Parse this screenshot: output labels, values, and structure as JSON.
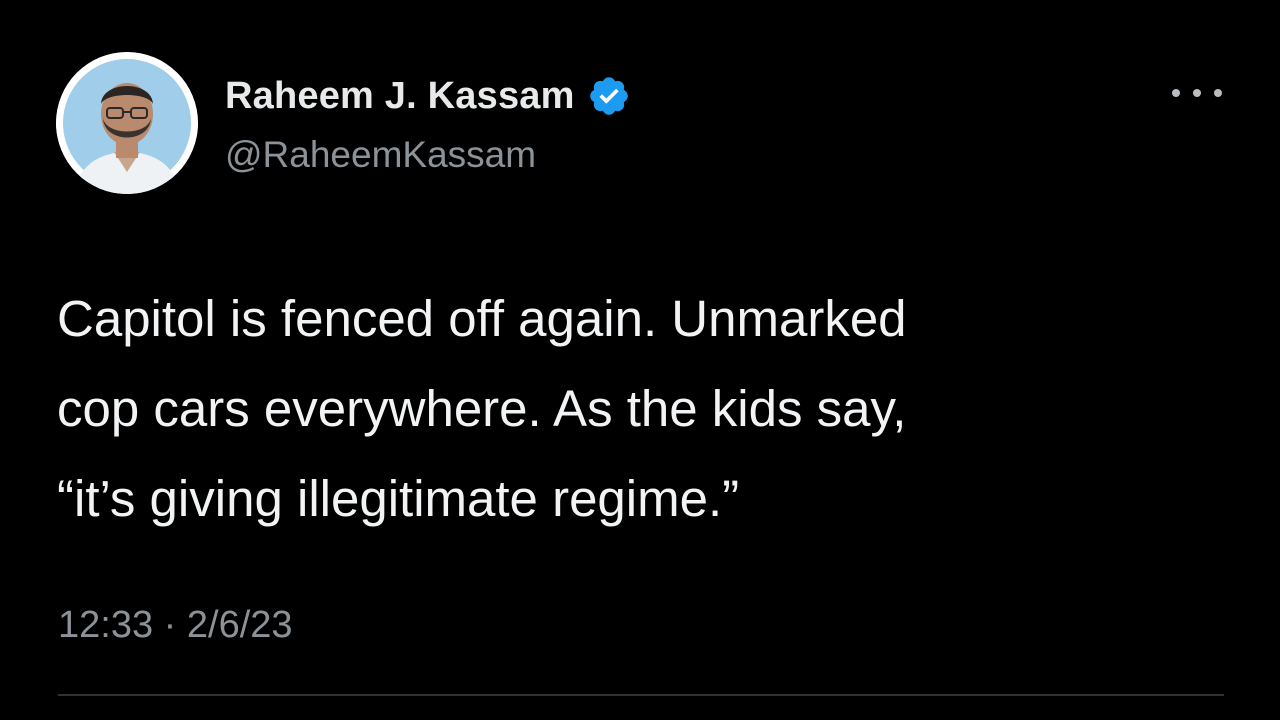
{
  "author": {
    "display_name": "Raheem J. Kassam",
    "handle": "@RaheemKassam",
    "verified": true
  },
  "tweet": {
    "text": "Capitol is fenced off again. Unmarked\ncop cars everywhere. As the kids say,\n“it’s giving illegitimate regime.”",
    "time": "12:33",
    "separator": " · ",
    "date": "2/6/23"
  },
  "icons": {
    "verified": "verified-badge-icon",
    "more": "more-options-icon"
  },
  "colors": {
    "background": "#000000",
    "text": "#e7e9ea",
    "secondary_text": "#8b9298",
    "verified_blue": "#1d9bf0",
    "divider": "#2f3336"
  }
}
